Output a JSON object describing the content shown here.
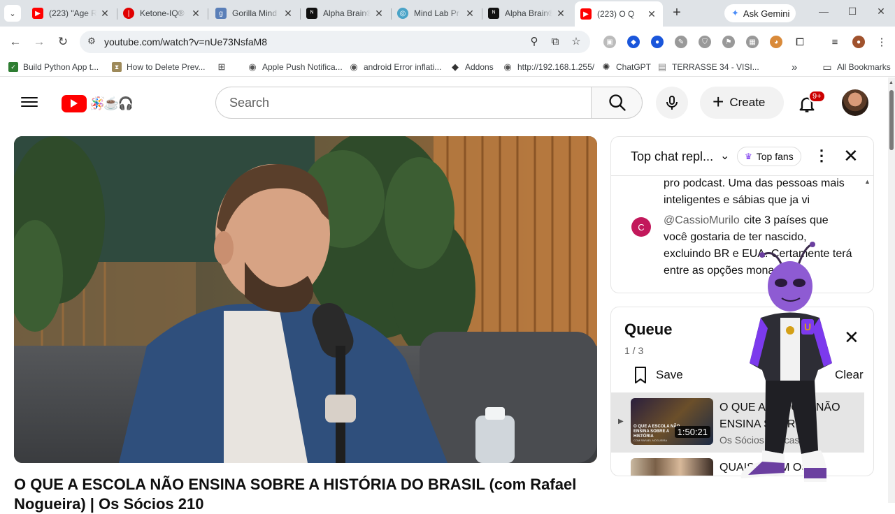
{
  "browser": {
    "tabs": [
      {
        "label": "(223) \"Age R",
        "color": "#ff0000",
        "glyph": "▶"
      },
      {
        "label": "Ketone-IQ®",
        "color": "#e00000",
        "glyph": "|"
      },
      {
        "label": "Gorilla Mind",
        "color": "#5a7fb8",
        "glyph": "g"
      },
      {
        "label": "Alpha Brain®",
        "color": "#111111",
        "glyph": "ᴺ"
      },
      {
        "label": "Mind Lab Pr",
        "color": "#4aa3c7",
        "glyph": "◎"
      },
      {
        "label": "Alpha Brain®",
        "color": "#111111",
        "glyph": "ᴺ"
      },
      {
        "label": "(223) O Q",
        "color": "#ff0000",
        "glyph": "▶"
      }
    ],
    "new_tab": "+",
    "gemini_label": "Ask Gemini",
    "url": "youtube.com/watch?v=nUe73NsfaM8",
    "bookmarks": [
      {
        "label": "Build Python App t...",
        "color": "#2e7d32",
        "glyph": "✓"
      },
      {
        "label": "How to Delete Prev...",
        "color": "#9e8a5a",
        "glyph": "⧗"
      },
      {
        "label": "",
        "color": "#444444",
        "glyph": "⊞"
      },
      {
        "label": "Apple Push Notifica...",
        "color": "#555555",
        "glyph": "◉"
      },
      {
        "label": "android Error inflati...",
        "color": "#555555",
        "glyph": "◉"
      },
      {
        "label": "Addons",
        "color": "#333333",
        "glyph": "◆"
      },
      {
        "label": "http://192.168.1.255/",
        "color": "#555555",
        "glyph": "◉"
      },
      {
        "label": "ChatGPT",
        "color": "#333333",
        "glyph": "✺"
      },
      {
        "label": "TERRASSE 34 - VISI...",
        "color": "#888888",
        "glyph": "▤"
      }
    ],
    "bookmarks_more": "»",
    "all_bookmarks": "All Bookmarks"
  },
  "youtube": {
    "search_placeholder": "Search",
    "create_label": "Create",
    "notifications_badge": "9+",
    "video_title_line1": "O QUE A ESCOLA NÃO ENSINA SOBRE A HISTÓRIA DO BRASIL (com Rafael",
    "video_title_line2": "Nogueira) | Os Sócios 210"
  },
  "chat": {
    "title": "Top chat repl...",
    "top_fans_label": "Top fans",
    "message1_text": "pro podcast. Uma das pessoas mais inteligentes e sábias que ja vi",
    "message2_avatar": "C",
    "message2_author": "@CassioMurilo",
    "message2_text": "cite 3 países que você gostaria de ter nascido, excluindo BR e EUA. Certamente terá entre as opções monarquia."
  },
  "queue": {
    "title": "Queue",
    "position": "1 / 3",
    "save_label": "Save",
    "clear_label": "Clear",
    "items": [
      {
        "title": "O QUE A ESCOLA NÃO ENSINA SOBRE",
        "channel": "Os Sócios Podcast",
        "duration": "1:50:21",
        "thumb_text": "O QUE A ESCOLA NÃO ENSINA SOBRE A HISTÓRIA",
        "thumb_sub": "COM RAFAEL NOGUEIRA"
      },
      {
        "title": "QUAIS ERAM OS",
        "channel": "",
        "duration": "",
        "thumb_text": "",
        "thumb_sub": ""
      }
    ]
  },
  "mascot": {
    "jacket_letter": "U"
  }
}
